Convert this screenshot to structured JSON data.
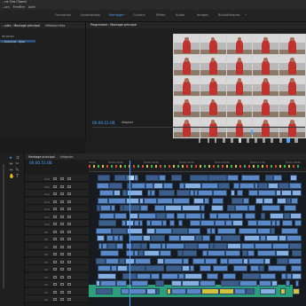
{
  "window": {
    "title": "...ne Ora Choral"
  },
  "menu": {
    "items": [
      "...ion",
      "Fenêtre",
      "Aide"
    ]
  },
  "workspaces": {
    "tabs": [
      {
        "label": "Formation",
        "active": false
      },
      {
        "label": "Assemblage",
        "active": false
      },
      {
        "label": "Montage",
        "active": true
      },
      {
        "label": "Couleur",
        "active": false
      },
      {
        "label": "Effets",
        "active": false
      },
      {
        "label": "Audio",
        "active": false
      },
      {
        "label": "Images",
        "active": false
      },
      {
        "label": "Bibliothèques",
        "active": false
      }
    ]
  },
  "source": {
    "tabs": [
      "...udio : Montage principal",
      "Métadonnées"
    ],
    "clip_time": "00:00:00",
    "clip_name": "...Soloduet : Oper"
  },
  "program": {
    "title": "Programme : Montage principal",
    "timecode": "00:00:51:08",
    "fit": "Adapter",
    "grid_rows": 5,
    "grid_cols": 5
  },
  "timeline": {
    "tabs": [
      {
        "label": "Montage principal",
        "active": true
      },
      {
        "label": "Intégrale",
        "active": false
      }
    ],
    "timecode": "00:00:51:08",
    "ruler": [
      "00:00",
      "00:00:15:00",
      "00:00:30:00",
      "00:00:45:00",
      "00:01:00:00",
      "00:01:15:00",
      "00:01:30:00"
    ],
    "tracks": [
      "V16",
      "V15",
      "V14",
      "V13",
      "V12",
      "V11",
      "V10",
      "V9",
      "V8",
      "V7",
      "V6",
      "V5",
      "V4",
      "V3",
      "V2",
      "V1",
      "A1"
    ]
  },
  "colors": {
    "accent": "#4aa3ff",
    "clip_video": "#5a88c6",
    "clip_audio": "#2fa07e"
  }
}
